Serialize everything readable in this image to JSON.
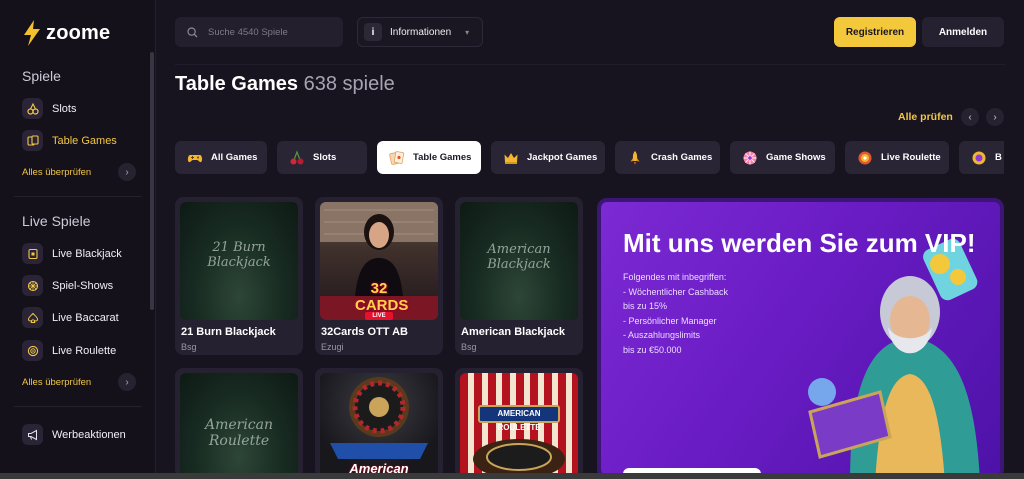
{
  "brand": {
    "name": "zoome"
  },
  "sidebar": {
    "section1_title": "Spiele",
    "section1_items": [
      {
        "label": "Slots",
        "icon": "cherries-icon"
      },
      {
        "label": "Table Games",
        "icon": "cards-icon"
      }
    ],
    "section1_more": "Alles überprüfen",
    "section2_title": "Live Spiele",
    "section2_items": [
      {
        "label": "Live Blackjack",
        "icon": "blackjack-card-icon"
      },
      {
        "label": "Spiel-Shows",
        "icon": "game-show-icon"
      },
      {
        "label": "Live Baccarat",
        "icon": "spade-icon"
      },
      {
        "label": "Live Roulette",
        "icon": "roulette-icon"
      }
    ],
    "section2_more": "Alles überprüfen",
    "promo_label": "Werbeaktionen"
  },
  "header": {
    "search_placeholder": "Suche 4540 Spiele",
    "info_label": "Informationen",
    "register_label": "Registrieren",
    "login_label": "Anmelden"
  },
  "page": {
    "title": "Table Games",
    "count": "638 spiele",
    "check_all": "Alle prüfen"
  },
  "categories": [
    {
      "label": "All Games",
      "icon": "gamepad-icon"
    },
    {
      "label": "Slots",
      "icon": "cherries-icon"
    },
    {
      "label": "Table Games",
      "icon": "cards-icon",
      "active": true
    },
    {
      "label": "Jackpot Games",
      "icon": "crown-icon"
    },
    {
      "label": "Crash Games",
      "icon": "rocket-icon"
    },
    {
      "label": "Game Shows",
      "icon": "wheel-icon"
    },
    {
      "label": "Live Roulette",
      "icon": "roulette-icon"
    },
    {
      "label": "B",
      "icon": "chip-icon"
    }
  ],
  "games": [
    {
      "name": "21 Burn Blackjack",
      "provider": "Bsg",
      "art": "21 Burn Blackjack"
    },
    {
      "name": "32Cards OTT AB",
      "provider": "Ezugi",
      "art": "32 CARDS",
      "badge": "LIVE"
    },
    {
      "name": "American Blackjack",
      "provider": "Bsg",
      "art": "American Blackjack"
    },
    {
      "art": "American Roulette"
    },
    {
      "art": "American ROULETTE"
    },
    {
      "art": "AMERICAN ROULETTE"
    }
  ],
  "vip": {
    "title": "Mit uns werden Sie zum VIP!",
    "lines": [
      "Folgendes mit inbegriffen:",
      "- Wöchentlicher Cashback",
      "bis zu 15%",
      "- Persönlicher Manager",
      "- Auszahlungslimits",
      "bis zu €50.000"
    ]
  },
  "colors": {
    "accent": "#f3c93b",
    "background": "#17131f",
    "vip": "#7c2ad3"
  }
}
